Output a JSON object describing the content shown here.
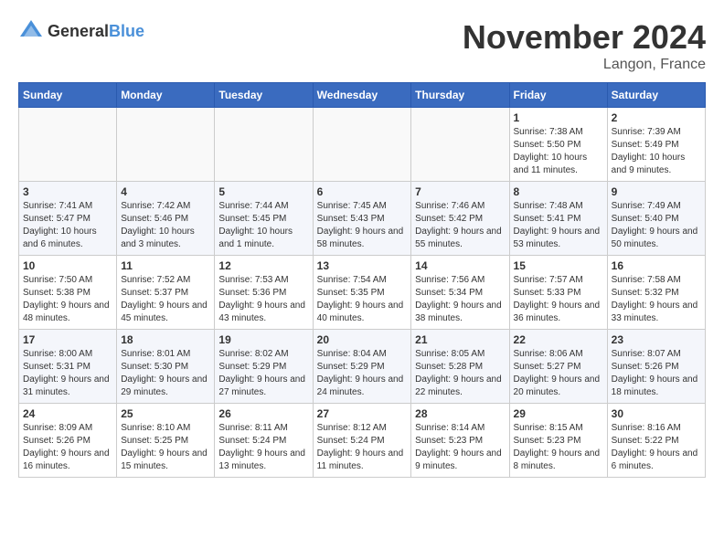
{
  "header": {
    "logo_general": "General",
    "logo_blue": "Blue",
    "month": "November 2024",
    "location": "Langon, France"
  },
  "weekdays": [
    "Sunday",
    "Monday",
    "Tuesday",
    "Wednesday",
    "Thursday",
    "Friday",
    "Saturday"
  ],
  "weeks": [
    [
      {
        "day": "",
        "info": ""
      },
      {
        "day": "",
        "info": ""
      },
      {
        "day": "",
        "info": ""
      },
      {
        "day": "",
        "info": ""
      },
      {
        "day": "",
        "info": ""
      },
      {
        "day": "1",
        "info": "Sunrise: 7:38 AM\nSunset: 5:50 PM\nDaylight: 10 hours and 11 minutes."
      },
      {
        "day": "2",
        "info": "Sunrise: 7:39 AM\nSunset: 5:49 PM\nDaylight: 10 hours and 9 minutes."
      }
    ],
    [
      {
        "day": "3",
        "info": "Sunrise: 7:41 AM\nSunset: 5:47 PM\nDaylight: 10 hours and 6 minutes."
      },
      {
        "day": "4",
        "info": "Sunrise: 7:42 AM\nSunset: 5:46 PM\nDaylight: 10 hours and 3 minutes."
      },
      {
        "day": "5",
        "info": "Sunrise: 7:44 AM\nSunset: 5:45 PM\nDaylight: 10 hours and 1 minute."
      },
      {
        "day": "6",
        "info": "Sunrise: 7:45 AM\nSunset: 5:43 PM\nDaylight: 9 hours and 58 minutes."
      },
      {
        "day": "7",
        "info": "Sunrise: 7:46 AM\nSunset: 5:42 PM\nDaylight: 9 hours and 55 minutes."
      },
      {
        "day": "8",
        "info": "Sunrise: 7:48 AM\nSunset: 5:41 PM\nDaylight: 9 hours and 53 minutes."
      },
      {
        "day": "9",
        "info": "Sunrise: 7:49 AM\nSunset: 5:40 PM\nDaylight: 9 hours and 50 minutes."
      }
    ],
    [
      {
        "day": "10",
        "info": "Sunrise: 7:50 AM\nSunset: 5:38 PM\nDaylight: 9 hours and 48 minutes."
      },
      {
        "day": "11",
        "info": "Sunrise: 7:52 AM\nSunset: 5:37 PM\nDaylight: 9 hours and 45 minutes."
      },
      {
        "day": "12",
        "info": "Sunrise: 7:53 AM\nSunset: 5:36 PM\nDaylight: 9 hours and 43 minutes."
      },
      {
        "day": "13",
        "info": "Sunrise: 7:54 AM\nSunset: 5:35 PM\nDaylight: 9 hours and 40 minutes."
      },
      {
        "day": "14",
        "info": "Sunrise: 7:56 AM\nSunset: 5:34 PM\nDaylight: 9 hours and 38 minutes."
      },
      {
        "day": "15",
        "info": "Sunrise: 7:57 AM\nSunset: 5:33 PM\nDaylight: 9 hours and 36 minutes."
      },
      {
        "day": "16",
        "info": "Sunrise: 7:58 AM\nSunset: 5:32 PM\nDaylight: 9 hours and 33 minutes."
      }
    ],
    [
      {
        "day": "17",
        "info": "Sunrise: 8:00 AM\nSunset: 5:31 PM\nDaylight: 9 hours and 31 minutes."
      },
      {
        "day": "18",
        "info": "Sunrise: 8:01 AM\nSunset: 5:30 PM\nDaylight: 9 hours and 29 minutes."
      },
      {
        "day": "19",
        "info": "Sunrise: 8:02 AM\nSunset: 5:29 PM\nDaylight: 9 hours and 27 minutes."
      },
      {
        "day": "20",
        "info": "Sunrise: 8:04 AM\nSunset: 5:29 PM\nDaylight: 9 hours and 24 minutes."
      },
      {
        "day": "21",
        "info": "Sunrise: 8:05 AM\nSunset: 5:28 PM\nDaylight: 9 hours and 22 minutes."
      },
      {
        "day": "22",
        "info": "Sunrise: 8:06 AM\nSunset: 5:27 PM\nDaylight: 9 hours and 20 minutes."
      },
      {
        "day": "23",
        "info": "Sunrise: 8:07 AM\nSunset: 5:26 PM\nDaylight: 9 hours and 18 minutes."
      }
    ],
    [
      {
        "day": "24",
        "info": "Sunrise: 8:09 AM\nSunset: 5:26 PM\nDaylight: 9 hours and 16 minutes."
      },
      {
        "day": "25",
        "info": "Sunrise: 8:10 AM\nSunset: 5:25 PM\nDaylight: 9 hours and 15 minutes."
      },
      {
        "day": "26",
        "info": "Sunrise: 8:11 AM\nSunset: 5:24 PM\nDaylight: 9 hours and 13 minutes."
      },
      {
        "day": "27",
        "info": "Sunrise: 8:12 AM\nSunset: 5:24 PM\nDaylight: 9 hours and 11 minutes."
      },
      {
        "day": "28",
        "info": "Sunrise: 8:14 AM\nSunset: 5:23 PM\nDaylight: 9 hours and 9 minutes."
      },
      {
        "day": "29",
        "info": "Sunrise: 8:15 AM\nSunset: 5:23 PM\nDaylight: 9 hours and 8 minutes."
      },
      {
        "day": "30",
        "info": "Sunrise: 8:16 AM\nSunset: 5:22 PM\nDaylight: 9 hours and 6 minutes."
      }
    ]
  ]
}
